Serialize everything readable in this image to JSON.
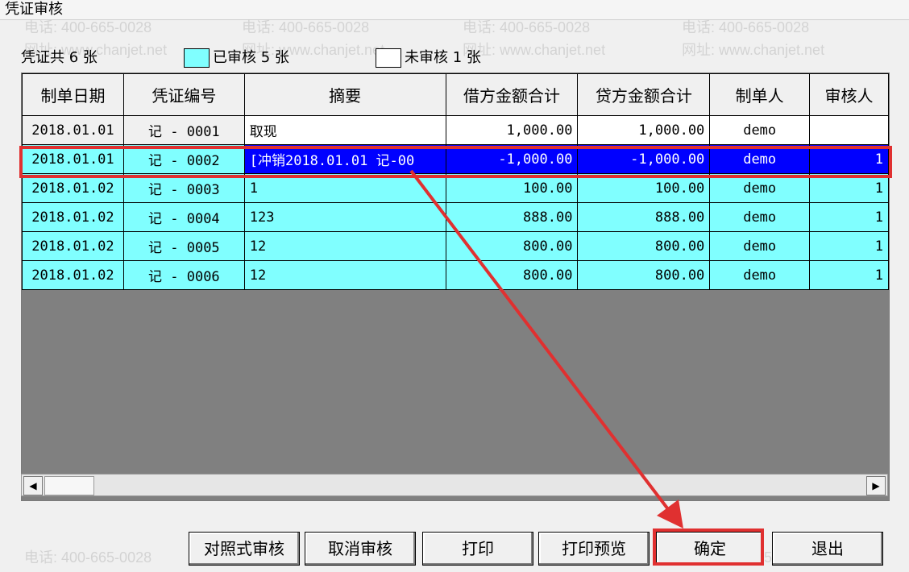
{
  "window": {
    "title": "凭证审核"
  },
  "summary": {
    "total": "凭证共 6 张",
    "audited_label": "已审核 5 张",
    "unaudited_label": "未审核 1 张",
    "audited_color": "#80ffff",
    "unaudited_color": "#ffffff"
  },
  "table": {
    "headers": [
      "制单日期",
      "凭证编号",
      "摘要",
      "借方金额合计",
      "贷方金额合计",
      "制单人",
      "审核人"
    ],
    "rows": [
      {
        "date": "2018.01.01",
        "no": "记 - 0001",
        "summary": "取现",
        "debit": "1,000.00",
        "credit": "1,000.00",
        "maker": "demo",
        "auditor": ""
      },
      {
        "date": "2018.01.01",
        "no": "记 - 0002",
        "summary": "[冲销2018.01.01 记-00",
        "debit": "-1,000.00",
        "credit": "-1,000.00",
        "maker": "demo",
        "auditor": "1"
      },
      {
        "date": "2018.01.02",
        "no": "记 - 0003",
        "summary": "1",
        "debit": "100.00",
        "credit": "100.00",
        "maker": "demo",
        "auditor": "1"
      },
      {
        "date": "2018.01.02",
        "no": "记 - 0004",
        "summary": "123",
        "debit": "888.00",
        "credit": "888.00",
        "maker": "demo",
        "auditor": "1"
      },
      {
        "date": "2018.01.02",
        "no": "记 - 0005",
        "summary": "12",
        "debit": "800.00",
        "credit": "800.00",
        "maker": "demo",
        "auditor": "1"
      },
      {
        "date": "2018.01.02",
        "no": "记 - 0006",
        "summary": "12",
        "debit": "800.00",
        "credit": "800.00",
        "maker": "demo",
        "auditor": "1"
      }
    ]
  },
  "scrollbar": {
    "left_icon": "left-arrow-icon",
    "right_icon": "right-arrow-icon"
  },
  "buttons": {
    "compare": "对照式审核",
    "cancel_audit": "取消审核",
    "print": "打印",
    "preview": "打印预览",
    "confirm": "确定",
    "exit": "退出"
  },
  "watermark": {
    "phone": "电话: 400-665-0028",
    "site": "网址: www.chanjet.net"
  },
  "colors": {
    "selected": "#0000ff",
    "highlight": "#e03030"
  }
}
